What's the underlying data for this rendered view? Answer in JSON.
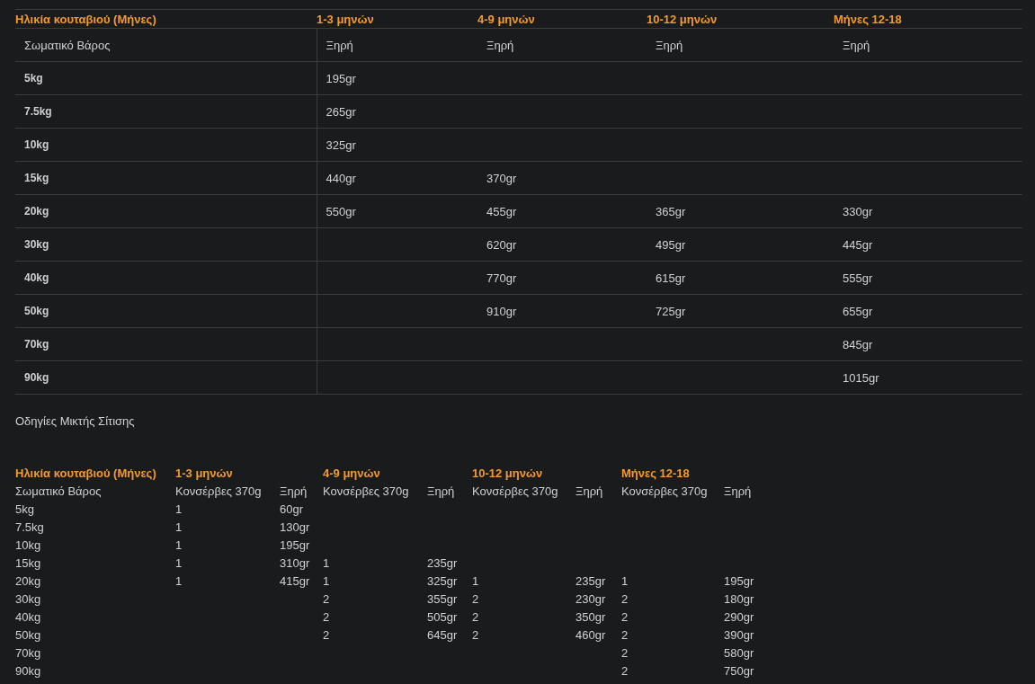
{
  "dry_table": {
    "age_header": "Ηλικία κουταβιού (Μήνες)",
    "age_columns": [
      "1-3 μηνών",
      "4-9 μηνών",
      "10-12 μηνών",
      "Μήνες 12-18"
    ],
    "weight_header": "Σωματικό Βάρος",
    "food_headers": [
      "Ξηρή",
      "Ξηρή",
      "Ξηρή",
      "Ξηρή"
    ],
    "rows": [
      {
        "weight": "5kg",
        "m1_3": "195gr"
      },
      {
        "weight": "7.5kg",
        "m1_3": "265gr"
      },
      {
        "weight": "10kg",
        "m1_3": "325gr"
      },
      {
        "weight": "15kg",
        "m1_3": "440gr",
        "m4_9": "370gr"
      },
      {
        "weight": "20kg",
        "m1_3": "550gr",
        "m4_9": "455gr",
        "m10_12": "365gr",
        "m12_18": "330gr"
      },
      {
        "weight": "30kg",
        "m4_9": "620gr",
        "m10_12": "495gr",
        "m12_18": "445gr"
      },
      {
        "weight": "40kg",
        "m4_9": "770gr",
        "m10_12": "615gr",
        "m12_18": "555gr"
      },
      {
        "weight": "50kg",
        "m4_9": "910gr",
        "m10_12": "725gr",
        "m12_18": "655gr"
      },
      {
        "weight": "70kg",
        "m12_18": "845gr"
      },
      {
        "weight": "90kg",
        "m12_18": "1015gr"
      }
    ]
  },
  "mixed_title": "Οδηγίες Μικτής Σίτισης",
  "mixed_table": {
    "age_header": "Ηλικία κουταβιού (Μήνες)",
    "age_columns": [
      "1-3 μηνών",
      "4-9 μηνών",
      "10-12 μηνών",
      "Μήνες 12-18"
    ],
    "weight_header": "Σωματικό Βάρος",
    "sub_headers": [
      "Κονσέρβες 370g",
      "Ξηρή",
      "Κονσέρβες 370g",
      "Ξηρή",
      "Κονσέρβες 370g",
      "Ξηρή",
      "Κονσέρβες 370g",
      "Ξηρή"
    ],
    "rows": [
      {
        "weight": "5kg",
        "cans_1_3": "1",
        "dry_1_3": "60gr"
      },
      {
        "weight": "7.5kg",
        "cans_1_3": "1",
        "dry_1_3": "130gr"
      },
      {
        "weight": "10kg",
        "cans_1_3": "1",
        "dry_1_3": "195gr"
      },
      {
        "weight": "15kg",
        "cans_1_3": "1",
        "dry_1_3": "310gr",
        "cans_4_9": "1",
        "dry_4_9": "235gr"
      },
      {
        "weight": "20kg",
        "cans_1_3": "1",
        "dry_1_3": "415gr",
        "cans_4_9": "1",
        "dry_4_9": "325gr",
        "cans_10_12": "1",
        "dry_10_12": "235gr",
        "cans_12_18": "1",
        "dry_12_18": "195gr"
      },
      {
        "weight": "30kg",
        "cans_4_9": "2",
        "dry_4_9": "355gr",
        "cans_10_12": "2",
        "dry_10_12": "230gr",
        "cans_12_18": "2",
        "dry_12_18": "180gr"
      },
      {
        "weight": "40kg",
        "cans_4_9": "2",
        "dry_4_9": "505gr",
        "cans_10_12": "2",
        "dry_10_12": "350gr",
        "cans_12_18": "2",
        "dry_12_18": "290gr"
      },
      {
        "weight": "50kg",
        "cans_4_9": "2",
        "dry_4_9": "645gr",
        "cans_10_12": "2",
        "dry_10_12": "460gr",
        "cans_12_18": "2",
        "dry_12_18": "390gr"
      },
      {
        "weight": "70kg",
        "cans_12_18": "2",
        "dry_12_18": "580gr"
      },
      {
        "weight": "90kg",
        "cans_12_18": "2",
        "dry_12_18": "750gr"
      }
    ]
  }
}
